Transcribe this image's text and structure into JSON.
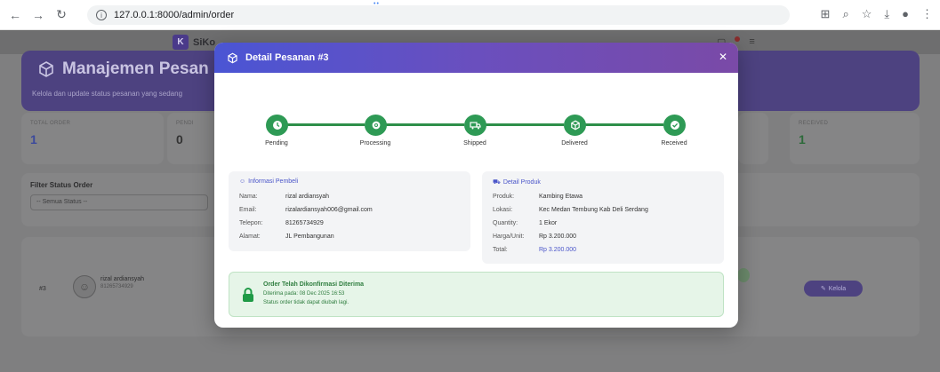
{
  "browser": {
    "url": "127.0.0.1:8000/admin/order"
  },
  "app": {
    "brand_letter": "K",
    "brand_name": "SiKo",
    "page_title": "Manajemen Pesan",
    "page_subtitle": "Kelola dan update status pesanan yang sedang",
    "stats": [
      {
        "label": "TOTAL ORDER",
        "value": "1"
      },
      {
        "label": "PENDI",
        "value": "0"
      },
      {
        "label": "RECEIVED",
        "value": "1"
      }
    ],
    "filter": {
      "label": "Filter Status Order",
      "selected": "-- Semua Status --"
    },
    "table_row": {
      "id": "#3",
      "name": "rizal ardiansyah",
      "phone": "81265734929",
      "action_label": "Kelola"
    }
  },
  "modal": {
    "title": "Detail Pesanan #3",
    "steps": [
      {
        "label": "Pending",
        "icon": "clock-icon"
      },
      {
        "label": "Processing",
        "icon": "gear-icon"
      },
      {
        "label": "Shipped",
        "icon": "truck-icon"
      },
      {
        "label": "Delivered",
        "icon": "box-icon"
      },
      {
        "label": "Received",
        "icon": "check-icon"
      }
    ],
    "buyer": {
      "title": "Informasi Pembeli",
      "fields": [
        {
          "k": "Nama:",
          "v": "rizal ardiansyah"
        },
        {
          "k": "Email:",
          "v": "rizalardiansyah006@gmail.com"
        },
        {
          "k": "Telepon:",
          "v": "81265734929"
        },
        {
          "k": "Alamat:",
          "v": "JL Pembangunan"
        }
      ]
    },
    "product": {
      "title": "Detail Produk",
      "fields": [
        {
          "k": "Produk:",
          "v": "Kambing Etawa"
        },
        {
          "k": "Lokasi:",
          "v": "Kec Medan Tembung Kab Deli Serdang"
        },
        {
          "k": "Quantity:",
          "v": "1 Ekor"
        },
        {
          "k": "Harga/Unit:",
          "v": "Rp 3.200.000"
        },
        {
          "k": "Total:",
          "v": "Rp 3.200.000"
        }
      ]
    },
    "alert": {
      "title": "Order Telah Dikonfirmasi Diterima",
      "line1": "Diterima pada: 08 Dec 2025 16:53",
      "line2": "Status order tidak dapat diubah lagi."
    }
  },
  "colors": {
    "accent": "#5a50c8",
    "success": "#2e9a55",
    "header_start": "#4a55d4",
    "header_end": "#7a4aa7"
  }
}
